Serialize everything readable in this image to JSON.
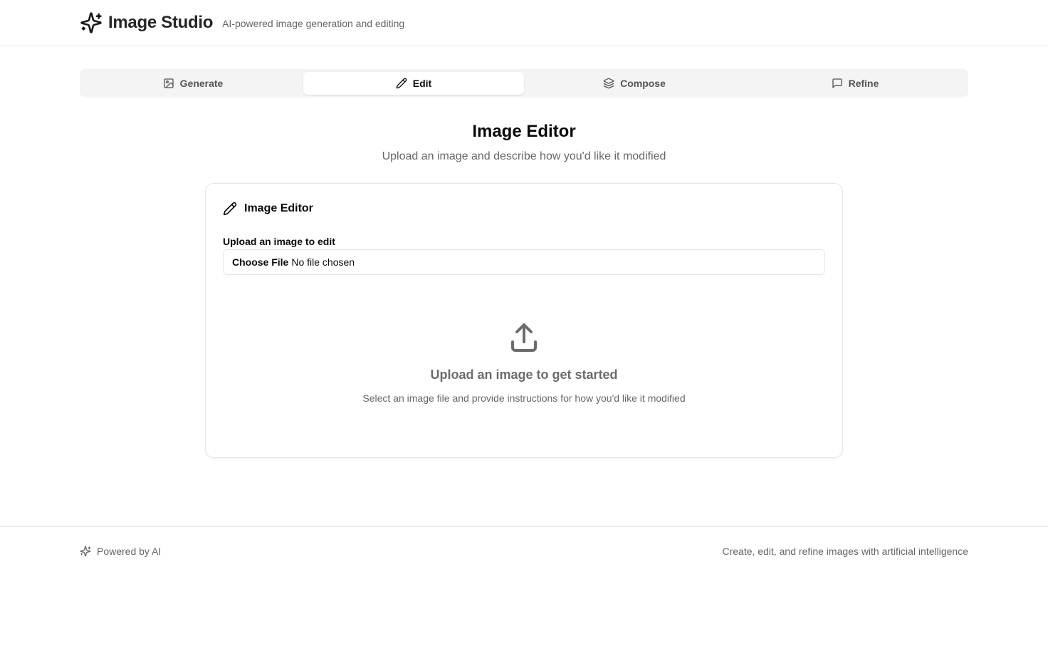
{
  "header": {
    "logo_icon": "sparkles-icon",
    "title": "Image Studio",
    "subtitle": "AI-powered image generation and editing"
  },
  "tabs": [
    {
      "label": "Generate",
      "icon": "image-icon",
      "active": false
    },
    {
      "label": "Edit",
      "icon": "pencil-icon",
      "active": true
    },
    {
      "label": "Compose",
      "icon": "layers-icon",
      "active": false
    },
    {
      "label": "Refine",
      "icon": "message-square-icon",
      "active": false
    }
  ],
  "main": {
    "title": "Image Editor",
    "description": "Upload an image and describe how you'd like it modified"
  },
  "card": {
    "icon": "pencil-icon",
    "title": "Image Editor",
    "upload_label": "Upload an image to edit",
    "file_button": "Choose File",
    "file_status": "No file chosen",
    "empty_icon": "upload-icon",
    "empty_title": "Upload an image to get started",
    "empty_desc": "Select an image file and provide instructions for how you'd like it modified"
  },
  "footer": {
    "left_icon": "sparkles-icon",
    "left_text": "Powered by AI",
    "right_text": "Create, edit, and refine images with artificial intelligence"
  }
}
